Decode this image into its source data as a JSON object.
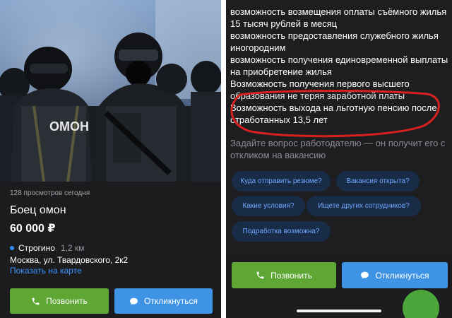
{
  "left": {
    "photo_label": "ОМОН",
    "views_text": "128 просмотров сегодня",
    "job_title": "Боец омон",
    "salary": "60 000 ₽",
    "metro": {
      "station": "Строгино",
      "distance": "1,2 км"
    },
    "address": "Москва, ул. Твардовского, 2к2",
    "map_link": "Показать на карте",
    "call_label": "Позвонить",
    "respond_label": "Откликнуться"
  },
  "right": {
    "perks": [
      "возможность возмещения оплаты съёмного жилья",
      "15 тысяч рублей в месяц",
      "возможность предоставления служебного жилья",
      "иногородним",
      "возможность получения единовременной выплаты",
      "на приобретение жилья",
      "Возможность получения первого высшего",
      "образования не теряя заработной платы",
      "Возможность выхода на льготную пенсию после",
      "отработанных 13,5 лет"
    ],
    "hint_lines": [
      "Задайте вопрос работодателю — он получит его с",
      "откликом на вакансию"
    ],
    "questions": [
      "Куда отправить резюме?",
      "Вакансия открыта?",
      "Какие условия?",
      "Ищете других сотрудников?",
      "Подработка возможна?"
    ],
    "call_label": "Позвонить",
    "respond_label": "Откликнуться"
  },
  "colors": {
    "background": "#1c1c1f",
    "call_button": "#5ea734",
    "respond_button": "#3f93e4",
    "link": "#3a93ff",
    "chip_bg": "#182c48",
    "chip_text": "#6fa8ff",
    "highlight_ellipse": "#d8201f"
  }
}
